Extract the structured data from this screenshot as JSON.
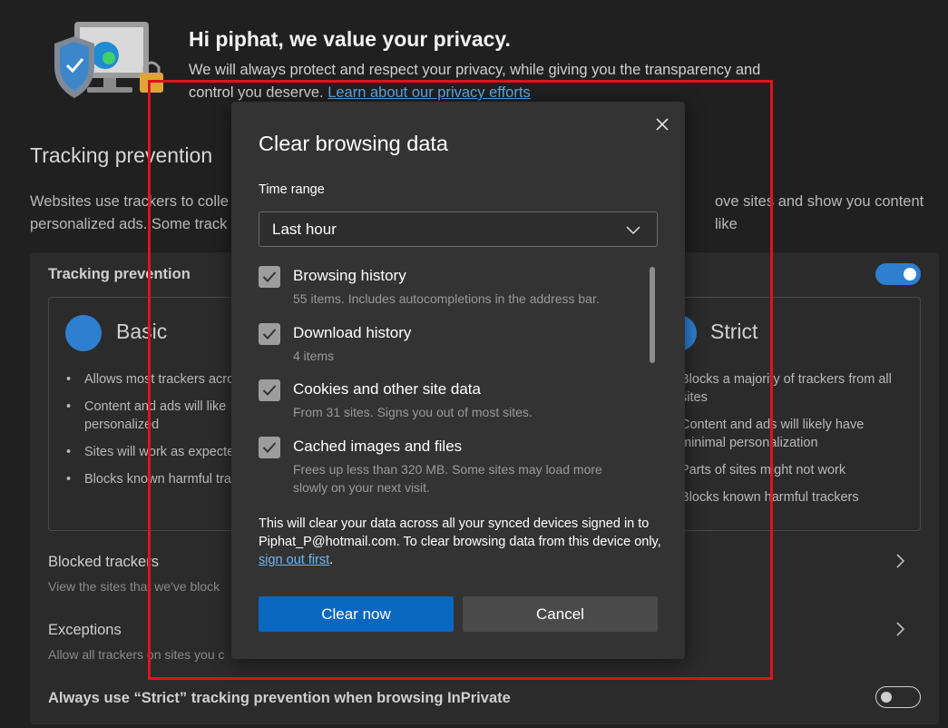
{
  "hero": {
    "title": "Hi piphat, we value your privacy.",
    "text": "We will always protect and respect your privacy, while giving you the transparency and control you deserve.",
    "link": "Learn about our privacy efforts"
  },
  "tracking": {
    "heading": "Tracking prevention",
    "description": "Websites use trackers to colle",
    "description_right": "ove sites and show you content like",
    "description_line2": "personalized ads. Some track",
    "label": "Tracking prevention",
    "enabled": true,
    "basic": {
      "title": "Basic",
      "bullets": [
        "Allows most trackers acro",
        "Content and ads will like personalized",
        "Sites will work as expecte",
        "Blocks known harmful tra"
      ]
    },
    "strict": {
      "title": "Strict",
      "bullets": [
        "Blocks a majority of trackers from all sites",
        "Content and ads will likely have minimal personalization",
        "Parts of sites might not work",
        "Blocks known harmful trackers"
      ]
    }
  },
  "rows": {
    "blocked_title": "Blocked trackers",
    "blocked_sub": "View the sites that we've block",
    "exceptions_title": "Exceptions",
    "exceptions_sub": "Allow all trackers on sites you c",
    "inprivate_title": "Always use “Strict” tracking prevention when browsing InPrivate",
    "inprivate_enabled": false
  },
  "dialog": {
    "title": "Clear browsing data",
    "time_range_label": "Time range",
    "time_range_value": "Last hour",
    "items": [
      {
        "title": "Browsing history",
        "desc": "55 items. Includes autocompletions in the address bar.",
        "checked": true
      },
      {
        "title": "Download history",
        "desc": "4 items",
        "checked": true
      },
      {
        "title": "Cookies and other site data",
        "desc": "From 31 sites. Signs you out of most sites.",
        "checked": true
      },
      {
        "title": "Cached images and files",
        "desc": "Frees up less than 320 MB. Some sites may load more slowly on your next visit.",
        "checked": true
      }
    ],
    "notice": "This will clear your data across all your synced devices signed in to Piphat_P@hotmail.com. To clear browsing data from this device only,",
    "notice_link": "sign out first",
    "notice_end": ".",
    "clear_label": "Clear now",
    "cancel_label": "Cancel"
  },
  "colors": {
    "accent": "#0a67c0",
    "annotation": "#e0131d",
    "toggle_on": "#2f7fd1"
  }
}
